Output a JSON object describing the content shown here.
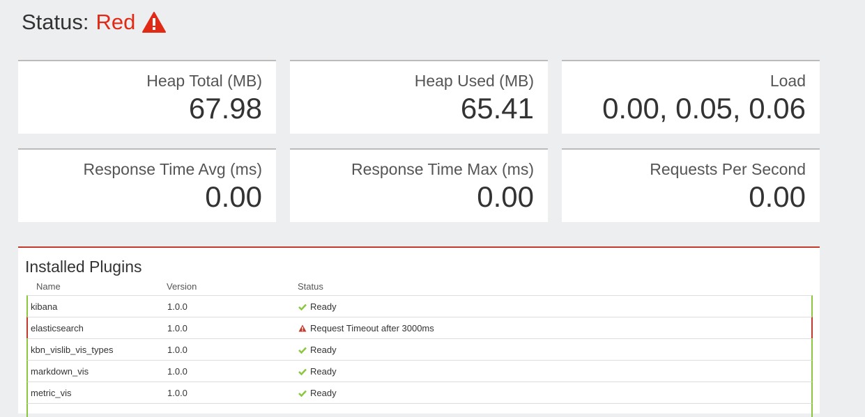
{
  "status": {
    "label": "Status:",
    "value": "Red",
    "icon": "warning-icon",
    "color": "#e02a16"
  },
  "metrics": [
    {
      "title": "Heap Total (MB)",
      "value": "67.98"
    },
    {
      "title": "Heap Used (MB)",
      "value": "65.41"
    },
    {
      "title": "Load",
      "value": "0.00, 0.05, 0.06"
    },
    {
      "title": "Response Time Avg (ms)",
      "value": "0.00"
    },
    {
      "title": "Response Time Max (ms)",
      "value": "0.00"
    },
    {
      "title": "Requests Per Second",
      "value": "0.00"
    }
  ],
  "plugins": {
    "title": "Installed Plugins",
    "columns": [
      "Name",
      "Version",
      "Status"
    ],
    "rows": [
      {
        "name": "kibana",
        "version": "1.0.0",
        "status": "Ready",
        "state": "green"
      },
      {
        "name": "elasticsearch",
        "version": "1.0.0",
        "status": "Request Timeout after 3000ms",
        "state": "red"
      },
      {
        "name": "kbn_vislib_vis_types",
        "version": "1.0.0",
        "status": "Ready",
        "state": "green"
      },
      {
        "name": "markdown_vis",
        "version": "1.0.0",
        "status": "Ready",
        "state": "green"
      },
      {
        "name": "metric_vis",
        "version": "1.0.0",
        "status": "Ready",
        "state": "green"
      }
    ]
  },
  "colors": {
    "green": "#8cc63f",
    "red": "#c0392b"
  }
}
